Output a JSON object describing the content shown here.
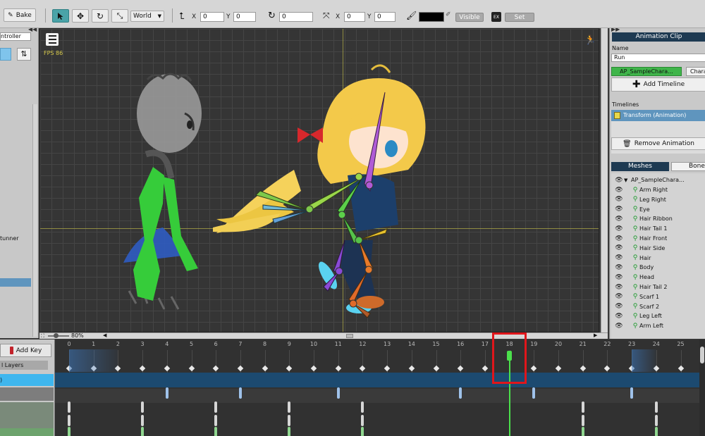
{
  "toolbar": {
    "bake_label": "Bake",
    "space_select": "World",
    "pos_x_label": "X",
    "pos_x_value": "0",
    "pos_y_label": "Y",
    "pos_y_value": "0",
    "rotation_value": "0",
    "scale_x_label": "X",
    "scale_x_value": "0",
    "scale_y_label": "Y",
    "scale_y_value": "0",
    "visible_label": "Visible",
    "set_label": "Set"
  },
  "left_panel": {
    "controller_label": "ntroller",
    "runner_label": "tunner"
  },
  "viewport": {
    "fps_label": "FPS 86",
    "zoom_label": "80%"
  },
  "right_panel": {
    "animation_clip_header": "Animation Clip",
    "name_label": "Name",
    "name_value": "Run",
    "target_tab_1": "AP_SampleChara...",
    "target_tab_2": "Charac",
    "add_timeline_label": "Add Timeline",
    "timelines_label": "Timelines",
    "timeline_item": "Transform (Animation)",
    "remove_animation_label": "Remove Animation",
    "meshes_tab": "Meshes",
    "bones_tab": "Bone",
    "root_item": "AP_SampleChara...",
    "meshes": [
      "Arm Right",
      "Leg Right",
      "Eye",
      "Hair Ribbon",
      "Hair Tail 1",
      "Hair Front",
      "Hair Side",
      "Hair",
      "Body",
      "Head",
      "Hair Tail 2",
      "Scarf 1",
      "Scarf 2",
      "Leg Left",
      "Arm Left"
    ]
  },
  "timeline": {
    "add_key_label": "Add Key",
    "all_layers_label": "l Layers",
    "selected_row_label": ")",
    "frames": [
      "0",
      "1",
      "2",
      "3",
      "4",
      "5",
      "6",
      "7",
      "8",
      "9",
      "10",
      "11",
      "12",
      "13",
      "14",
      "15",
      "16",
      "17",
      "18",
      "19",
      "20",
      "21",
      "22",
      "23",
      "24",
      "25"
    ],
    "current_frame": "18"
  },
  "colors": {
    "accent_teal": "#4aa3a8",
    "header_navy": "#1e3a52",
    "selection_blue": "#5ab0e4",
    "highlight_red": "#e0161b",
    "playhead_green": "#4be04b"
  }
}
